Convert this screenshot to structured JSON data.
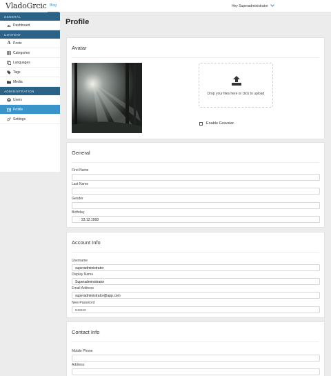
{
  "brand": "VladoGrcic",
  "nav": {
    "blog": "Blog"
  },
  "user_menu": "Hey Superadministrator",
  "sidebar": {
    "general": {
      "title": "GENERAL",
      "items": [
        {
          "label": "Dashboard",
          "icon": "dashboard-icon"
        }
      ]
    },
    "content": {
      "title": "CONTENT",
      "items": [
        {
          "label": "Posts",
          "icon": "font-icon"
        },
        {
          "label": "Categories",
          "icon": "categories-icon"
        },
        {
          "label": "Languages",
          "icon": "copy-icon"
        },
        {
          "label": "Tags",
          "icon": "tags-icon"
        },
        {
          "label": "Media",
          "icon": "folder-icon"
        }
      ]
    },
    "administration": {
      "title": "ADMINISTRATION",
      "items": [
        {
          "label": "Users",
          "icon": "user-circle-icon"
        },
        {
          "label": "Profile",
          "icon": "id-card-icon",
          "active": true
        },
        {
          "label": "Settings",
          "icon": "cogs-icon"
        }
      ]
    }
  },
  "page_title": "Profile",
  "avatar": {
    "title": "Avatar",
    "dropzone_text": "Drop your files here or click to upload",
    "gravatar_label": "Enable Gravatar."
  },
  "general": {
    "title": "General",
    "first_name": {
      "label": "First Name",
      "value": ""
    },
    "last_name": {
      "label": "Last Name",
      "value": ""
    },
    "gender": {
      "label": "Gender",
      "value": ""
    },
    "birthday": {
      "label": "Birthday",
      "value": "23.12.1993"
    }
  },
  "account": {
    "title": "Account Info",
    "username": {
      "label": "Username",
      "value": "superadministrator"
    },
    "display_name": {
      "label": "Display Name",
      "value": "Superadministrator"
    },
    "email": {
      "label": "Email Address",
      "value": "superadministrator@app.com"
    },
    "password": {
      "label": "New Password",
      "value": "•••••••••"
    }
  },
  "contact": {
    "title": "Contact Info",
    "mobile": {
      "label": "Mobile Phone",
      "value": ""
    },
    "address": {
      "label": "Address",
      "value": ""
    }
  },
  "colors": {
    "accent": "#3a94c9",
    "section_header": "#2c6285",
    "background": "#ececec"
  }
}
